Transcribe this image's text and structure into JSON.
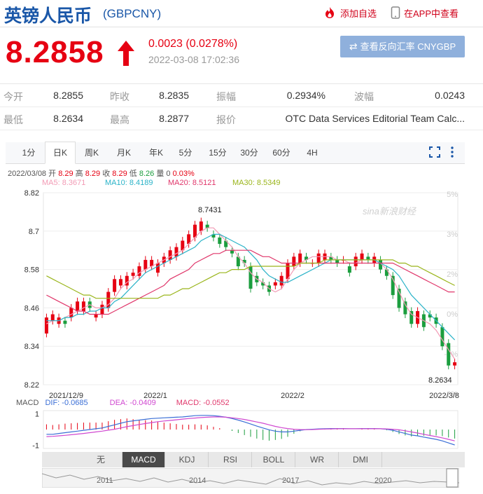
{
  "header": {
    "name": "英镑人民币",
    "code": "(GBPCNY)",
    "add_watch": "添加自选",
    "open_app": "在APP中查看"
  },
  "quote": {
    "price": "8.2858",
    "change": "0.0023 (0.0278%)",
    "timestamp": "2022-03-08 17:02:36",
    "reverse_button": "查看反向汇率 CNYGBP",
    "up_color": "#e60012"
  },
  "stats": {
    "row1": [
      {
        "label": "今开",
        "value": "8.2855"
      },
      {
        "label": "昨收",
        "value": "8.2835"
      },
      {
        "label": "振幅",
        "value": "0.2934%"
      },
      {
        "label": "波幅",
        "value": "0.0243"
      }
    ],
    "row2": [
      {
        "label": "最低",
        "value": "8.2634"
      },
      {
        "label": "最高",
        "value": "8.2877"
      },
      {
        "label": "报价",
        "value": "OTC Data Services Editorial Team Calc..."
      }
    ]
  },
  "period_tabs": [
    "1分",
    "日K",
    "周K",
    "月K",
    "年K",
    "5分",
    "15分",
    "30分",
    "60分",
    "4H"
  ],
  "active_period": "日K",
  "kline_info": {
    "date": "2022/03/08",
    "open_label": "开",
    "open": "8.29",
    "high_label": "高",
    "high": "8.29",
    "close_label": "收",
    "close": "8.29",
    "low_label": "低",
    "low": "8.26",
    "vol_label": "量",
    "vol": "0",
    "pct": "0.03%"
  },
  "ma_legend": [
    {
      "text": "MA5: 8.3671",
      "color": "#f29bb5"
    },
    {
      "text": "MA10: 8.4189",
      "color": "#2bb3c8"
    },
    {
      "text": "MA20: 8.5121",
      "color": "#e0376b"
    },
    {
      "text": "MA30: 8.5349",
      "color": "#9ab51b"
    }
  ],
  "watermark": "sina新浪财经",
  "macd_legend": {
    "label": "MACD",
    "dif": "DIF: -0.0685",
    "dea": "DEA: -0.0409",
    "macd": "MACD: -0.0552"
  },
  "indicator_tabs": [
    "无",
    "MACD",
    "KDJ",
    "RSI",
    "BOLL",
    "WR",
    "DMI"
  ],
  "active_indicator": "MACD",
  "nav_up": "▲",
  "nav_down": "▼",
  "timeline_years": [
    "2011",
    "2014",
    "2017",
    "2020"
  ],
  "chart_data": {
    "type": "candlestick",
    "y_ticks": [
      "8.82",
      "8.7",
      "8.58",
      "8.46",
      "8.34",
      "8.22"
    ],
    "ylim": [
      8.22,
      8.82
    ],
    "pct_ticks": [
      "5%",
      "3%",
      "2%",
      "0%",
      "-1%",
      "-2%"
    ],
    "x_labels": [
      "2021/12/9",
      "2022/1",
      "2022/2",
      "2022/3/8"
    ],
    "annotations": {
      "max": "8.7431",
      "min": "8.2634"
    },
    "candles": [
      [
        8.38,
        8.43
      ],
      [
        8.42,
        8.44
      ],
      [
        8.41,
        8.43
      ],
      [
        8.42,
        8.41
      ],
      [
        8.43,
        8.46
      ],
      [
        8.45,
        8.48
      ],
      [
        8.45,
        8.48
      ],
      [
        8.48,
        8.46
      ],
      [
        8.43,
        8.44
      ],
      [
        8.44,
        8.47
      ],
      [
        8.46,
        8.51
      ],
      [
        8.51,
        8.55
      ],
      [
        8.53,
        8.55
      ],
      [
        8.53,
        8.56
      ],
      [
        8.56,
        8.57
      ],
      [
        8.56,
        8.59
      ],
      [
        8.58,
        8.61
      ],
      [
        8.59,
        8.61
      ],
      [
        8.57,
        8.6
      ],
      [
        8.6,
        8.62
      ],
      [
        8.61,
        8.64
      ],
      [
        8.62,
        8.65
      ],
      [
        8.64,
        8.67
      ],
      [
        8.66,
        8.69
      ],
      [
        8.68,
        8.72
      ],
      [
        8.7,
        8.73
      ],
      [
        8.72,
        8.71
      ],
      [
        8.69,
        8.68
      ],
      [
        8.68,
        8.66
      ],
      [
        8.67,
        8.65
      ],
      [
        8.64,
        8.63
      ],
      [
        8.62,
        8.59
      ],
      [
        8.61,
        8.6
      ],
      [
        8.59,
        8.52
      ],
      [
        8.56,
        8.54
      ],
      [
        8.54,
        8.53
      ],
      [
        8.53,
        8.51
      ],
      [
        8.53,
        8.54
      ],
      [
        8.53,
        8.56
      ],
      [
        8.55,
        8.6
      ],
      [
        8.59,
        8.62
      ],
      [
        8.6,
        8.63
      ],
      [
        8.62,
        8.61
      ],
      [
        8.6,
        8.6
      ],
      [
        8.6,
        8.63
      ],
      [
        8.61,
        8.63
      ],
      [
        8.62,
        8.61
      ],
      [
        8.61,
        8.6
      ],
      [
        8.61,
        8.61
      ],
      [
        8.59,
        8.57
      ],
      [
        8.59,
        8.62
      ],
      [
        8.61,
        8.63
      ],
      [
        8.62,
        8.61
      ],
      [
        8.6,
        8.62
      ],
      [
        8.61,
        8.58
      ],
      [
        8.58,
        8.56
      ],
      [
        8.56,
        8.5
      ],
      [
        8.52,
        8.46
      ],
      [
        8.48,
        8.44
      ],
      [
        8.45,
        8.41
      ],
      [
        8.41,
        8.45
      ],
      [
        8.44,
        8.4
      ],
      [
        8.44,
        8.43
      ],
      [
        8.43,
        8.41
      ],
      [
        8.4,
        8.34
      ],
      [
        8.35,
        8.28
      ],
      [
        8.28,
        8.29
      ]
    ],
    "ma5": [
      8.41,
      8.42,
      8.42,
      8.43,
      8.44,
      8.45,
      8.46,
      8.47,
      8.46,
      8.46,
      8.47,
      8.49,
      8.52,
      8.54,
      8.55,
      8.57,
      8.58,
      8.59,
      8.6,
      8.61,
      8.62,
      8.63,
      8.64,
      8.66,
      8.68,
      8.7,
      8.71,
      8.71,
      8.69,
      8.67,
      8.65,
      8.62,
      8.6,
      8.57,
      8.55,
      8.54,
      8.52,
      8.51,
      8.52,
      8.55,
      8.58,
      8.6,
      8.61,
      8.62,
      8.62,
      8.62,
      8.62,
      8.61,
      8.61,
      8.6,
      8.6,
      8.61,
      8.61,
      8.61,
      8.6,
      8.58,
      8.55,
      8.51,
      8.47,
      8.44,
      8.43,
      8.42,
      8.41,
      8.39,
      8.36,
      8.33,
      8.3
    ],
    "ma10": [
      8.42,
      8.42,
      8.42,
      8.43,
      8.43,
      8.44,
      8.44,
      8.45,
      8.45,
      8.46,
      8.46,
      8.48,
      8.49,
      8.51,
      8.53,
      8.55,
      8.57,
      8.58,
      8.59,
      8.6,
      8.61,
      8.62,
      8.63,
      8.64,
      8.65,
      8.67,
      8.68,
      8.69,
      8.69,
      8.68,
      8.67,
      8.66,
      8.65,
      8.63,
      8.61,
      8.58,
      8.56,
      8.55,
      8.54,
      8.54,
      8.55,
      8.56,
      8.57,
      8.58,
      8.59,
      8.6,
      8.61,
      8.61,
      8.61,
      8.61,
      8.61,
      8.61,
      8.61,
      8.61,
      8.6,
      8.59,
      8.58,
      8.56,
      8.53,
      8.5,
      8.48,
      8.46,
      8.44,
      8.42,
      8.4,
      8.38,
      8.36
    ],
    "ma20": [
      8.5,
      8.49,
      8.48,
      8.47,
      8.46,
      8.45,
      8.45,
      8.44,
      8.44,
      8.44,
      8.44,
      8.45,
      8.46,
      8.47,
      8.48,
      8.49,
      8.5,
      8.51,
      8.52,
      8.53,
      8.55,
      8.56,
      8.57,
      8.58,
      8.6,
      8.61,
      8.62,
      8.63,
      8.63,
      8.64,
      8.64,
      8.64,
      8.64,
      8.64,
      8.63,
      8.62,
      8.62,
      8.61,
      8.6,
      8.6,
      8.6,
      8.6,
      8.6,
      8.6,
      8.6,
      8.6,
      8.6,
      8.6,
      8.6,
      8.6,
      8.6,
      8.6,
      8.6,
      8.6,
      8.6,
      8.6,
      8.6,
      8.59,
      8.58,
      8.57,
      8.56,
      8.55,
      8.54,
      8.53,
      8.52,
      8.51,
      8.51
    ],
    "ma30": [
      8.56,
      8.55,
      8.54,
      8.53,
      8.52,
      8.51,
      8.5,
      8.5,
      8.49,
      8.49,
      8.49,
      8.49,
      8.49,
      8.49,
      8.49,
      8.49,
      8.49,
      8.49,
      8.49,
      8.5,
      8.5,
      8.51,
      8.52,
      8.52,
      8.53,
      8.54,
      8.55,
      8.56,
      8.57,
      8.57,
      8.58,
      8.58,
      8.58,
      8.59,
      8.59,
      8.59,
      8.59,
      8.59,
      8.59,
      8.59,
      8.59,
      8.6,
      8.6,
      8.6,
      8.6,
      8.61,
      8.61,
      8.61,
      8.61,
      8.61,
      8.61,
      8.61,
      8.61,
      8.61,
      8.61,
      8.61,
      8.61,
      8.6,
      8.6,
      8.59,
      8.59,
      8.58,
      8.57,
      8.56,
      8.55,
      8.54,
      8.53
    ],
    "macd_y_ticks": [
      "1",
      "-1"
    ],
    "dif": [
      -0.3,
      -0.3,
      -0.25,
      -0.2,
      -0.15,
      -0.1,
      -0.05,
      0.0,
      0.05,
      0.1,
      0.2,
      0.3,
      0.4,
      0.5,
      0.55,
      0.6,
      0.65,
      0.7,
      0.72,
      0.74,
      0.76,
      0.78,
      0.8,
      0.84,
      0.88,
      0.9,
      0.9,
      0.88,
      0.84,
      0.78,
      0.7,
      0.6,
      0.48,
      0.35,
      0.22,
      0.1,
      -0.02,
      -0.1,
      -0.15,
      -0.15,
      -0.1,
      -0.05,
      0.0,
      0.02,
      0.04,
      0.05,
      0.06,
      0.06,
      0.06,
      0.05,
      0.05,
      0.06,
      0.06,
      0.06,
      0.05,
      0.02,
      -0.05,
      -0.15,
      -0.25,
      -0.35,
      -0.4,
      -0.48,
      -0.55,
      -0.62,
      -0.72,
      -0.85,
      -0.98
    ],
    "dea": [
      -0.45,
      -0.43,
      -0.4,
      -0.37,
      -0.33,
      -0.29,
      -0.25,
      -0.2,
      -0.15,
      -0.1,
      -0.04,
      0.02,
      0.1,
      0.18,
      0.25,
      0.32,
      0.38,
      0.44,
      0.5,
      0.54,
      0.58,
      0.62,
      0.66,
      0.7,
      0.73,
      0.76,
      0.78,
      0.8,
      0.8,
      0.78,
      0.74,
      0.7,
      0.64,
      0.56,
      0.48,
      0.4,
      0.3,
      0.2,
      0.12,
      0.06,
      0.02,
      0.0,
      -0.01,
      0.0,
      0.02,
      0.03,
      0.04,
      0.05,
      0.05,
      0.05,
      0.05,
      0.05,
      0.05,
      0.05,
      0.05,
      0.04,
      0.02,
      -0.02,
      -0.08,
      -0.15,
      -0.22,
      -0.3,
      -0.38,
      -0.45,
      -0.53,
      -0.62,
      -0.72
    ]
  }
}
